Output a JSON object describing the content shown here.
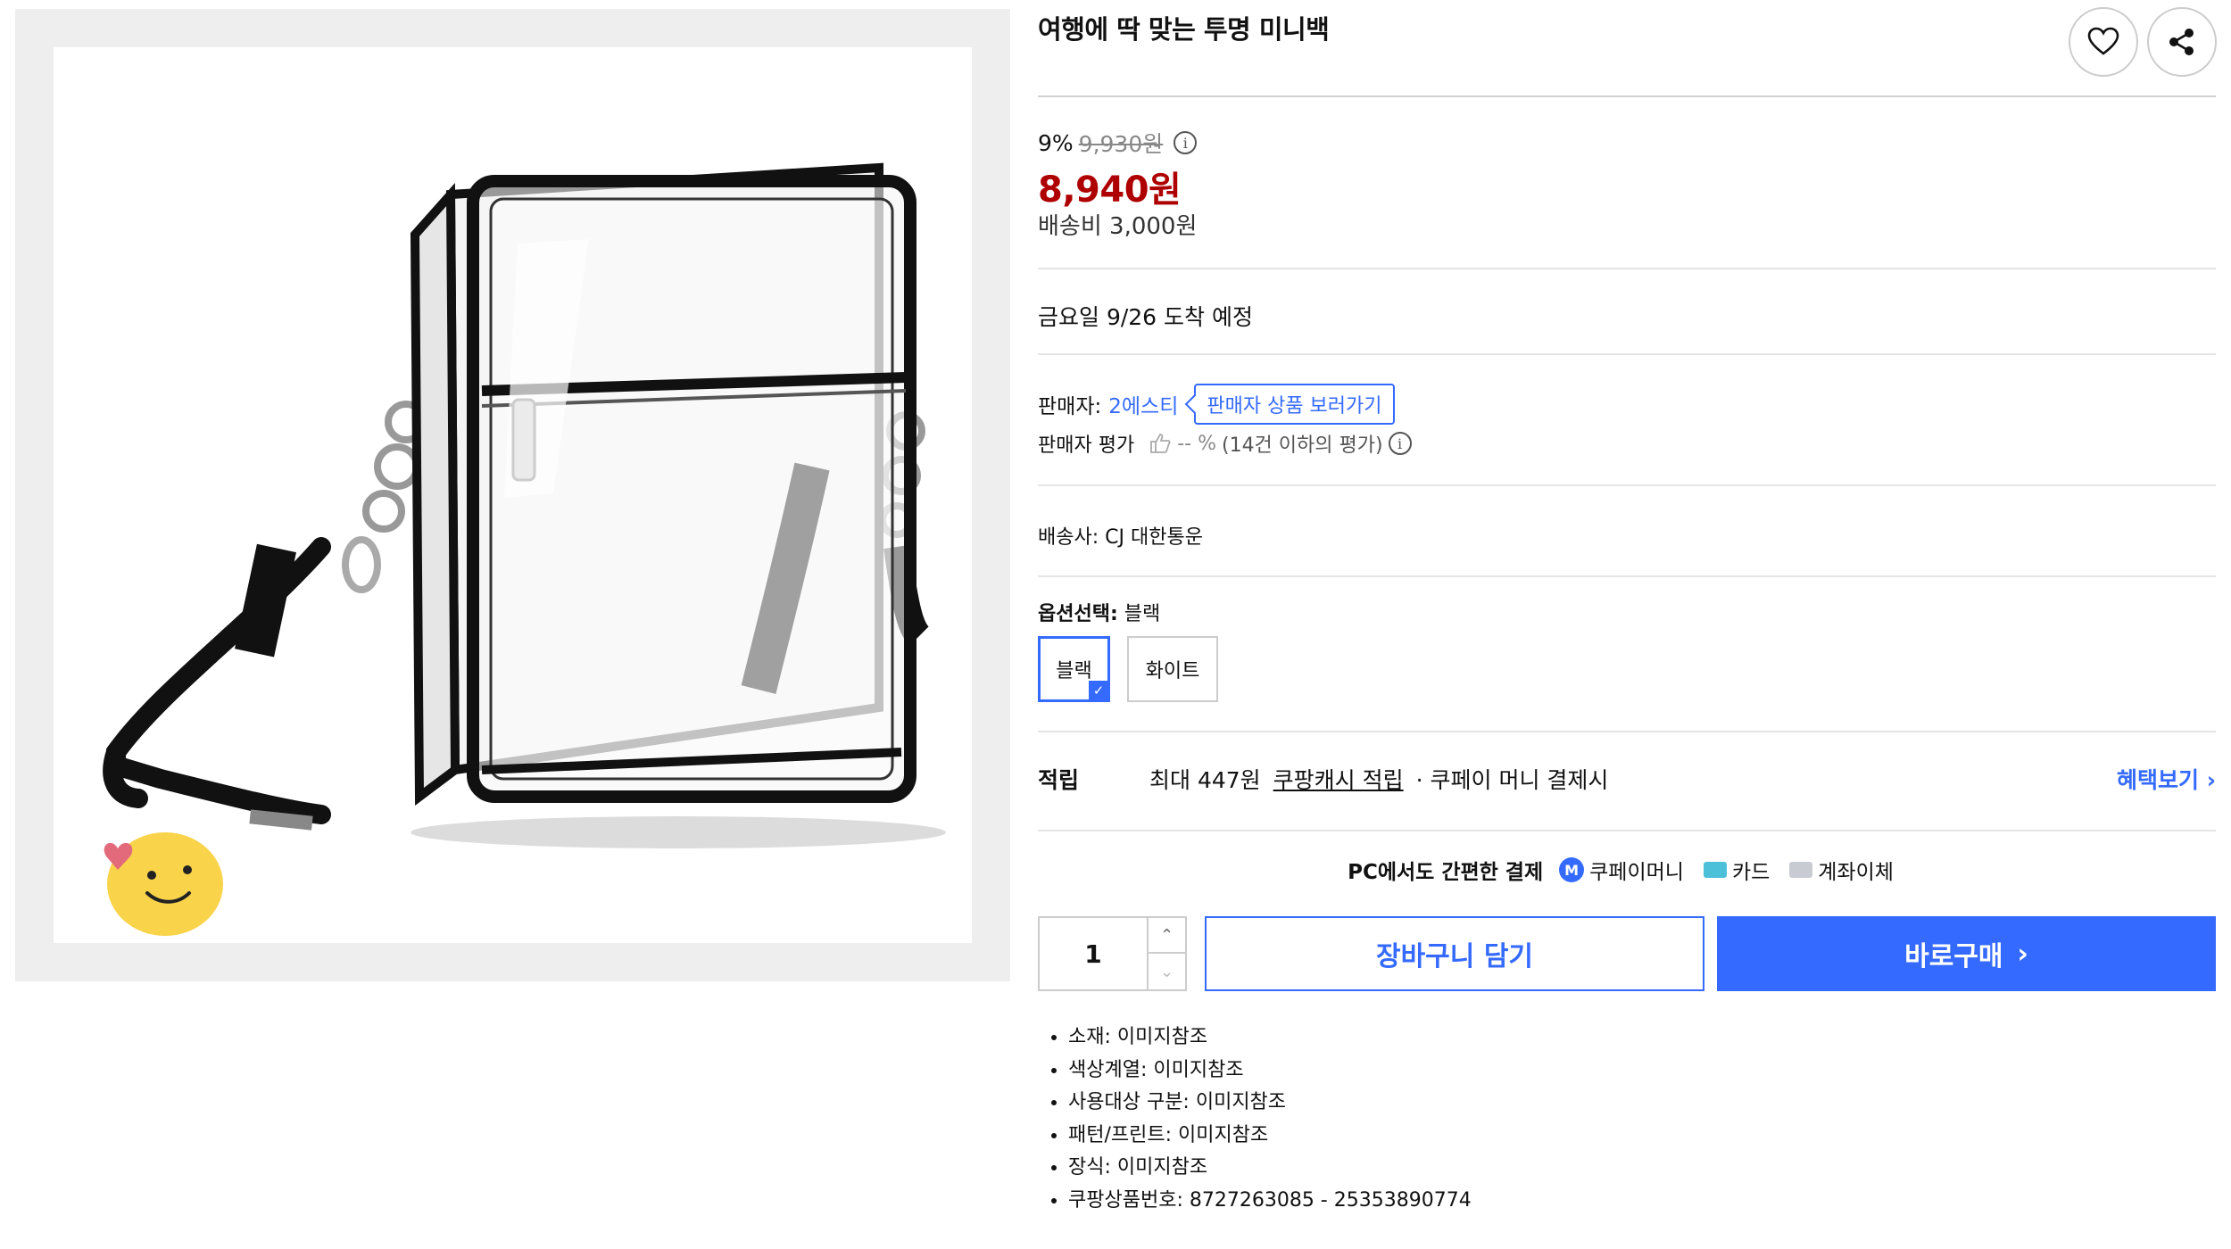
{
  "product": {
    "title": "여행에 딱 맞는 투명 미니백",
    "image_name": "clear-crossbody-mini-bag",
    "actions": {
      "wish_icon": "heart-icon",
      "share_icon": "share-icon"
    }
  },
  "price": {
    "discount_rate": "9%",
    "original_price": "9,930원",
    "sale_price": "8,940원",
    "shipping": "배송비 3,000원"
  },
  "delivery": {
    "arrival": "금요일 9/26 도착 예정"
  },
  "seller": {
    "label": "판매자:",
    "name": "2에스티",
    "link_label": "판매자 상품 보러가기",
    "rating_label": "판매자 평가",
    "rating_value": "-- %",
    "rating_note": "(14건 이하의 평가)"
  },
  "carrier": {
    "text": "배송사:  CJ 대한통운"
  },
  "options": {
    "label": "옵션선택:",
    "selected": "블랙",
    "items": [
      "블랙",
      "화이트"
    ]
  },
  "reward": {
    "label": "적립",
    "max": "최대 447원",
    "cash": "쿠팡캐시 적립",
    "condition": "· 쿠페이 머니 결제시",
    "link": "혜택보기"
  },
  "payment": {
    "title": "PC에서도 간편한 결제",
    "money_badge": "M",
    "methods": [
      "쿠페이머니",
      "카드",
      "계좌이체"
    ]
  },
  "purchase": {
    "quantity": "1",
    "cart_label": "장바구니 담기",
    "buy_label": "바로구매"
  },
  "attributes": [
    "소재: 이미지참조",
    "색상계열: 이미지참조",
    "사용대상 구분: 이미지참조",
    "패턴/프린트: 이미지참조",
    "장식: 이미지참조",
    "쿠팡상품번호: 8727263085 - 25353890774"
  ],
  "colors": {
    "accent": "#346aff",
    "sale": "#ae0000",
    "muted": "#888888"
  }
}
